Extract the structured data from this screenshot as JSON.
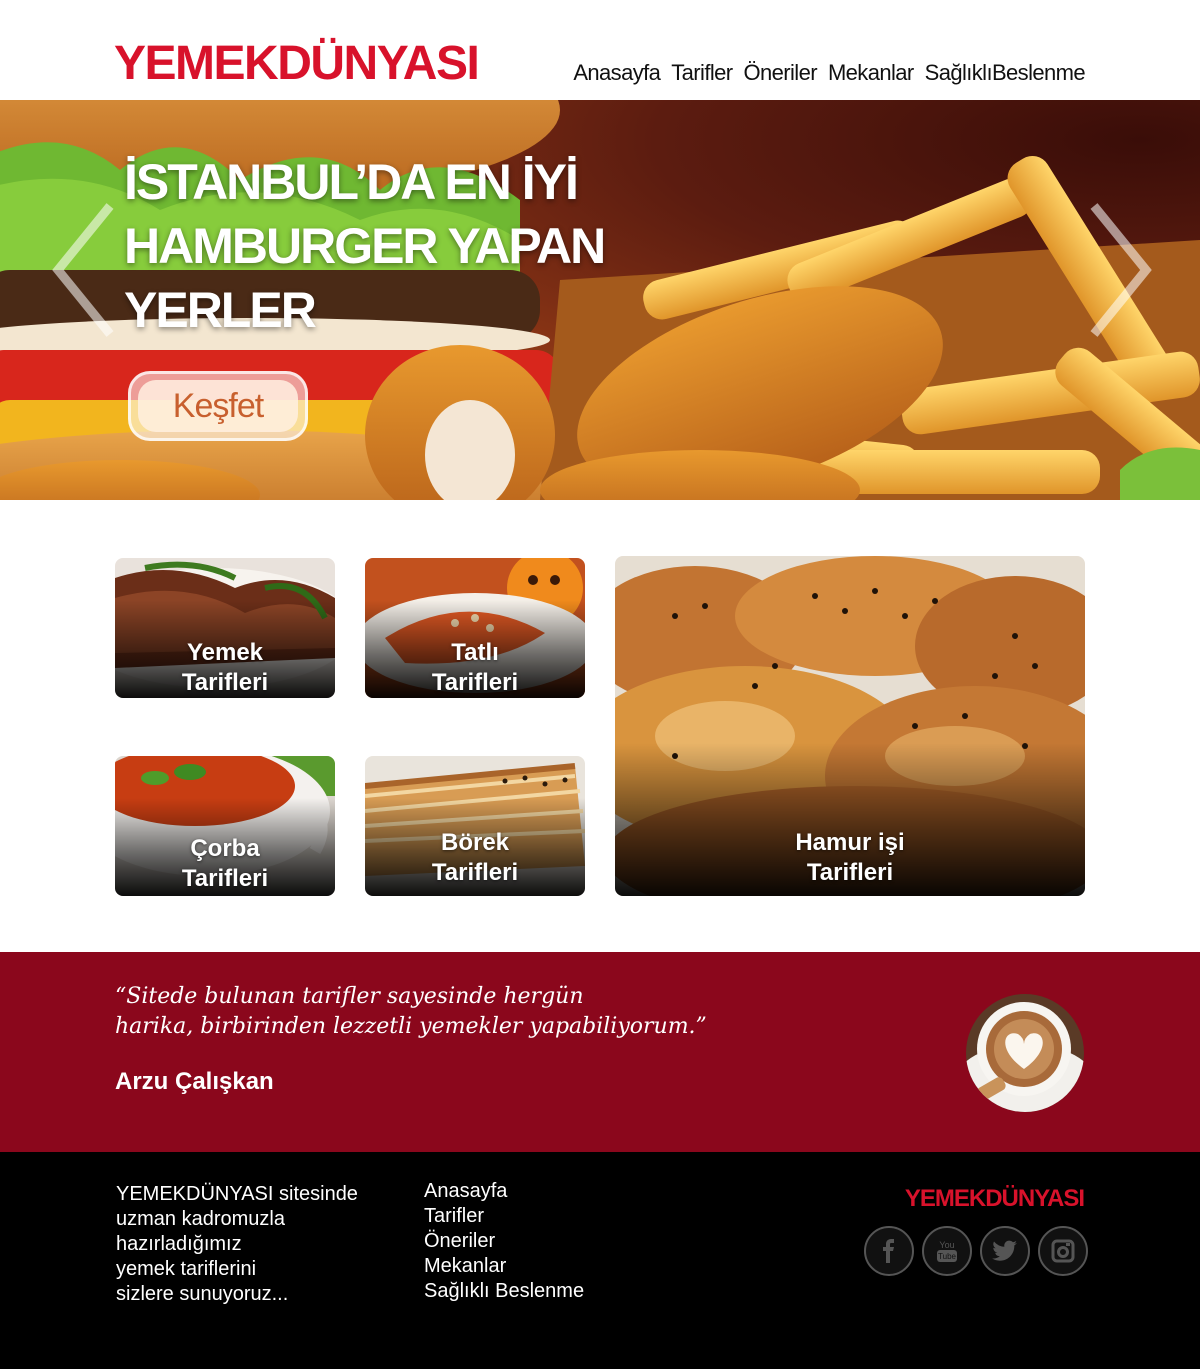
{
  "header": {
    "logo": "YEMEKDÜNYASI",
    "nav": [
      "Anasayfa",
      "Tarifler",
      "Öneriler",
      "Mekanlar",
      "SağlıklıBeslenme"
    ]
  },
  "hero": {
    "title_lines": [
      "İSTANBUL’DA EN İYİ",
      "HAMBURGER YAPAN",
      "YERLER"
    ],
    "cta": "Keşfet"
  },
  "categories": [
    {
      "line1": "Yemek",
      "line2": "Tarifleri"
    },
    {
      "line1": "Tatlı",
      "line2": "Tarifleri"
    },
    {
      "line1": "Çorba",
      "line2": "Tarifleri"
    },
    {
      "line1": "Börek",
      "line2": "Tarifleri"
    },
    {
      "line1": "Hamur işi",
      "line2": "Tarifleri"
    }
  ],
  "testimonial": {
    "quote_lines": [
      "“Sitede bulunan tarifler sayesinde hergün",
      "harika, birbirinden lezzetli yemekler yapabiliyorum.”"
    ],
    "author": "Arzu Çalışkan"
  },
  "footer": {
    "about_lines": [
      "YEMEKDÜNYASI sitesinde",
      "uzman kadromuzla",
      "hazırladığımız",
      "yemek tariflerini",
      "sizlere sunuyoruz..."
    ],
    "links": [
      "Anasayfa",
      "Tarifler",
      "Öneriler",
      "Mekanlar",
      "Sağlıklı Beslenme"
    ],
    "logo": "YEMEKDÜNYASI",
    "social_icons": [
      "facebook-icon",
      "youtube-icon",
      "twitter-icon",
      "instagram-icon"
    ]
  },
  "colors": {
    "brand_red": "#d8122b",
    "testimonial_bg": "#8b071c",
    "footer_bg": "#000000"
  }
}
